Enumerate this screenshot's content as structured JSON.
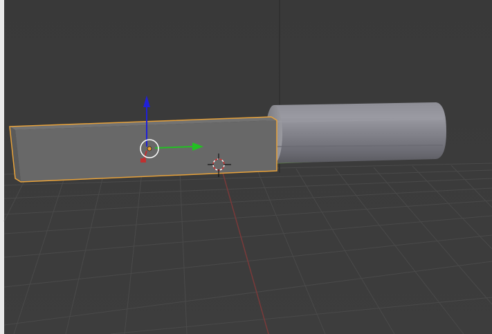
{
  "viewport": {
    "mode": "3d-perspective",
    "background_color": "#3a3a3a",
    "grid_line_color": "#4a4a4a",
    "axis_x_color": "#7a3a3a",
    "axis_y_color": "#5a8a3a",
    "axis_z_color": "#555555"
  },
  "objects": [
    {
      "name": "Cube",
      "shape": "box",
      "selected": true,
      "outline_color": "#e8a23a",
      "face_color": "#6a6a6a"
    },
    {
      "name": "Cylinder",
      "shape": "cylinder",
      "selected": false,
      "face_color": "#8a8a90"
    }
  ],
  "gizmo": {
    "x_color": "#c03030",
    "y_color": "#22c022",
    "z_color": "#2020d8",
    "origin_color": "#f0a030",
    "icon": "translate-manipulator-icon"
  },
  "cursor": {
    "icon": "3d-cursor-icon",
    "colors": [
      "#ffffff",
      "#d03030"
    ]
  }
}
